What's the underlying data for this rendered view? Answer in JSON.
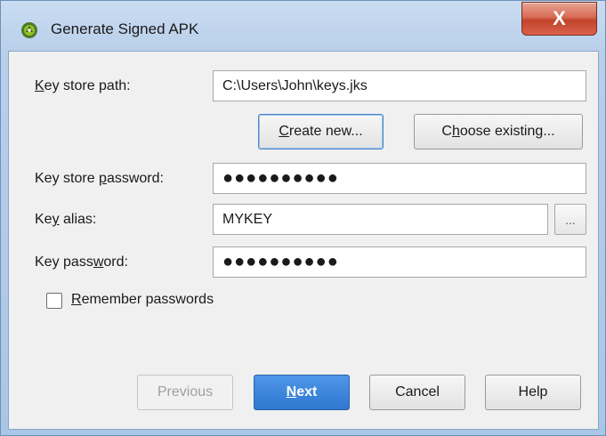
{
  "window": {
    "title": "Generate Signed APK",
    "close_label": "X"
  },
  "form": {
    "key_store_path_label": {
      "pre": "",
      "u": "K",
      "post": "ey store path:"
    },
    "key_store_path_value": "C:\\Users\\John\\keys.jks",
    "key_store_password_label": {
      "pre": "Key store ",
      "u": "p",
      "post": "assword:"
    },
    "key_store_password_value": "●●●●●●●●●●",
    "key_alias_label": {
      "pre": "Ke",
      "u": "y",
      "post": " alias:"
    },
    "key_alias_value": "MYKEY",
    "key_alias_browse": "...",
    "key_password_label": {
      "pre": "Key pass",
      "u": "w",
      "post": "ord:"
    },
    "key_password_value": "●●●●●●●●●●",
    "remember_label": {
      "pre": "",
      "u": "R",
      "post": "emember passwords"
    },
    "remember_checked": false
  },
  "buttons": {
    "create_new": {
      "pre": "",
      "u": "C",
      "post": "reate new..."
    },
    "choose_existing": {
      "pre": "C",
      "u": "h",
      "post": "oose existing..."
    },
    "previous": "Previous",
    "next": {
      "pre": "",
      "u": "N",
      "post": "ext"
    },
    "cancel": "Cancel",
    "help": "Help"
  },
  "colors": {
    "primary_button": "#2f77d0",
    "close_button": "#c1432b",
    "android_icon": "#97c024"
  }
}
